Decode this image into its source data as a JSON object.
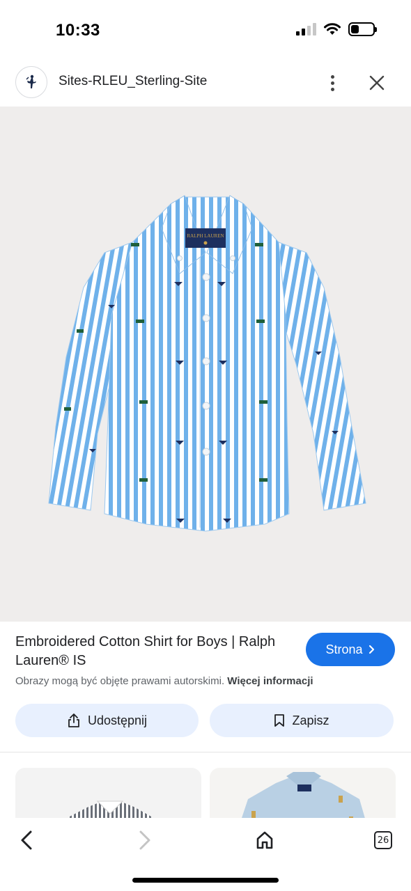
{
  "status_bar": {
    "time": "10:33"
  },
  "header": {
    "site_title": "Sites-RLEU_Sterling-Site",
    "favicon_icon": "polo-horse-icon",
    "more_icon": "more-vert-icon",
    "close_icon": "close-icon"
  },
  "image": {
    "subject": "shirt-image",
    "stripe_color": "#6fb1ea",
    "background_color": "#efedec"
  },
  "info": {
    "title": "Embroidered Cotton Shirt for Boys | Ralph Lauren® IS",
    "visit_label": "Strona",
    "copyright_text": "Obrazy mogą być objęte prawami autorskimi.",
    "more_info_label": "Więcej informacji",
    "share_label": "Udostępnij",
    "save_label": "Zapisz",
    "accent_color": "#1a73e8"
  },
  "bottom_nav": {
    "tab_count": "26"
  }
}
